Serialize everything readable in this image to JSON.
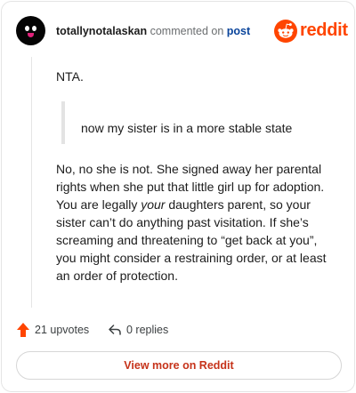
{
  "header": {
    "username": "totallynotalaskan",
    "action": "commented on",
    "target": "post",
    "brand": "reddit"
  },
  "comment": {
    "paragraph1": "NTA.",
    "quote": "now my sister is in a more stable state",
    "paragraph2_before": "No, no she is not. She signed away her parental rights when she put that little girl up for adoption. You are legally ",
    "paragraph2_em": "your",
    "paragraph2_after": " daughters parent, so your sister can’t do anything past visitation. If she’s screaming and threatening to “get back at you”, you might consider a restraining order, or at least an order of protection."
  },
  "actions": {
    "upvotes": "21 upvotes",
    "replies": "0 replies"
  },
  "view_more": "View more on Reddit",
  "colors": {
    "brand": "#ff4500",
    "link": "#0a449b",
    "button_text": "#c6331a",
    "upvote": "#ff4500"
  },
  "icons": {
    "avatar": "avatar",
    "brand": "reddit-snoo-icon",
    "upvote": "upvote-arrow-icon",
    "reply": "reply-arrow-icon"
  }
}
